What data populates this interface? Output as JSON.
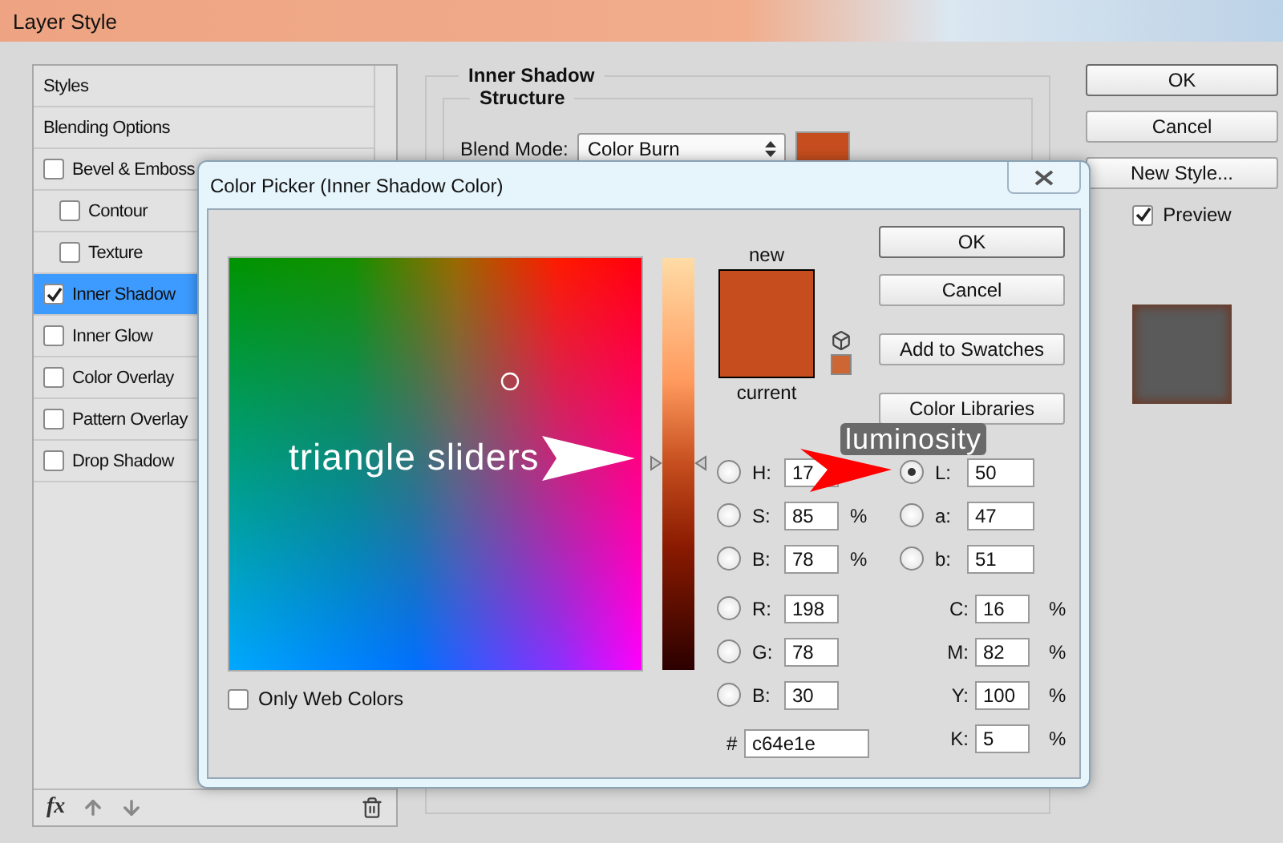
{
  "window": {
    "title": "Layer Style"
  },
  "styles_list": {
    "items": [
      {
        "label": "Styles",
        "kind": "header",
        "selected": false
      },
      {
        "label": "Blending Options",
        "kind": "header",
        "selected": false
      },
      {
        "label": "Bevel & Emboss",
        "kind": "check",
        "checked": false,
        "selected": false,
        "children": [
          {
            "label": "Contour",
            "kind": "check",
            "checked": false,
            "selected": false
          },
          {
            "label": "Texture",
            "kind": "check",
            "checked": false,
            "selected": false
          }
        ]
      },
      {
        "label": "Inner Shadow",
        "kind": "check",
        "checked": true,
        "selected": true
      },
      {
        "label": "Inner Glow",
        "kind": "check",
        "checked": false,
        "selected": false
      },
      {
        "label": "Color Overlay",
        "kind": "check",
        "checked": false,
        "selected": false
      },
      {
        "label": "Pattern Overlay",
        "kind": "check",
        "checked": false,
        "selected": false
      },
      {
        "label": "Drop Shadow",
        "kind": "check",
        "checked": false,
        "selected": false
      }
    ]
  },
  "toolbar": {
    "fx": "fx"
  },
  "settings": {
    "title": "Inner Shadow",
    "group": "Structure",
    "blend_mode": {
      "label": "Blend Mode:",
      "value": "Color Burn",
      "color": "#c64e1e"
    }
  },
  "buttons": [
    "OK",
    "Cancel",
    "New Style..."
  ],
  "preview": {
    "label": "Preview",
    "checked": true
  },
  "color_picker": {
    "title": "Color Picker (Inner Shadow Color)",
    "hue_slider": {
      "level": 0.5
    },
    "swatch": {
      "new_label": "new",
      "current_label": "current",
      "color": "#c64e1e"
    },
    "buttons": [
      "OK",
      "Cancel",
      "Add to Swatches",
      "Color Libraries"
    ],
    "only_web_colors": {
      "label": "Only Web Colors",
      "checked": false
    },
    "hsb_fields": [
      {
        "label": "H:",
        "value": "17",
        "selected": false
      },
      {
        "label": "S:",
        "value": "85",
        "unit": "%",
        "selected": false
      },
      {
        "label": "B:",
        "value": "78",
        "unit": "%",
        "selected": false
      }
    ],
    "rgb_fields": [
      {
        "label": "R:",
        "value": "198",
        "selected": false
      },
      {
        "label": "G:",
        "value": "78",
        "selected": false
      },
      {
        "label": "B:",
        "value": "30",
        "selected": false
      }
    ],
    "lab_fields": [
      {
        "label": "L:",
        "value": "50",
        "selected": true
      },
      {
        "label": "a:",
        "value": "47",
        "selected": false
      },
      {
        "label": "b:",
        "value": "51",
        "selected": false
      }
    ],
    "cmyk_fields": [
      {
        "label": "C:",
        "value": "16",
        "unit": "%"
      },
      {
        "label": "M:",
        "value": "82",
        "unit": "%"
      },
      {
        "label": "Y:",
        "value": "100",
        "unit": "%"
      },
      {
        "label": "K:",
        "value": "5",
        "unit": "%"
      }
    ],
    "hex": {
      "label": "#",
      "value": "c64e1e"
    }
  },
  "annotations": [
    {
      "text": "triangle sliders",
      "kind": "white-arrow"
    },
    {
      "text": "luminosity",
      "kind": "red-arrow"
    }
  ]
}
